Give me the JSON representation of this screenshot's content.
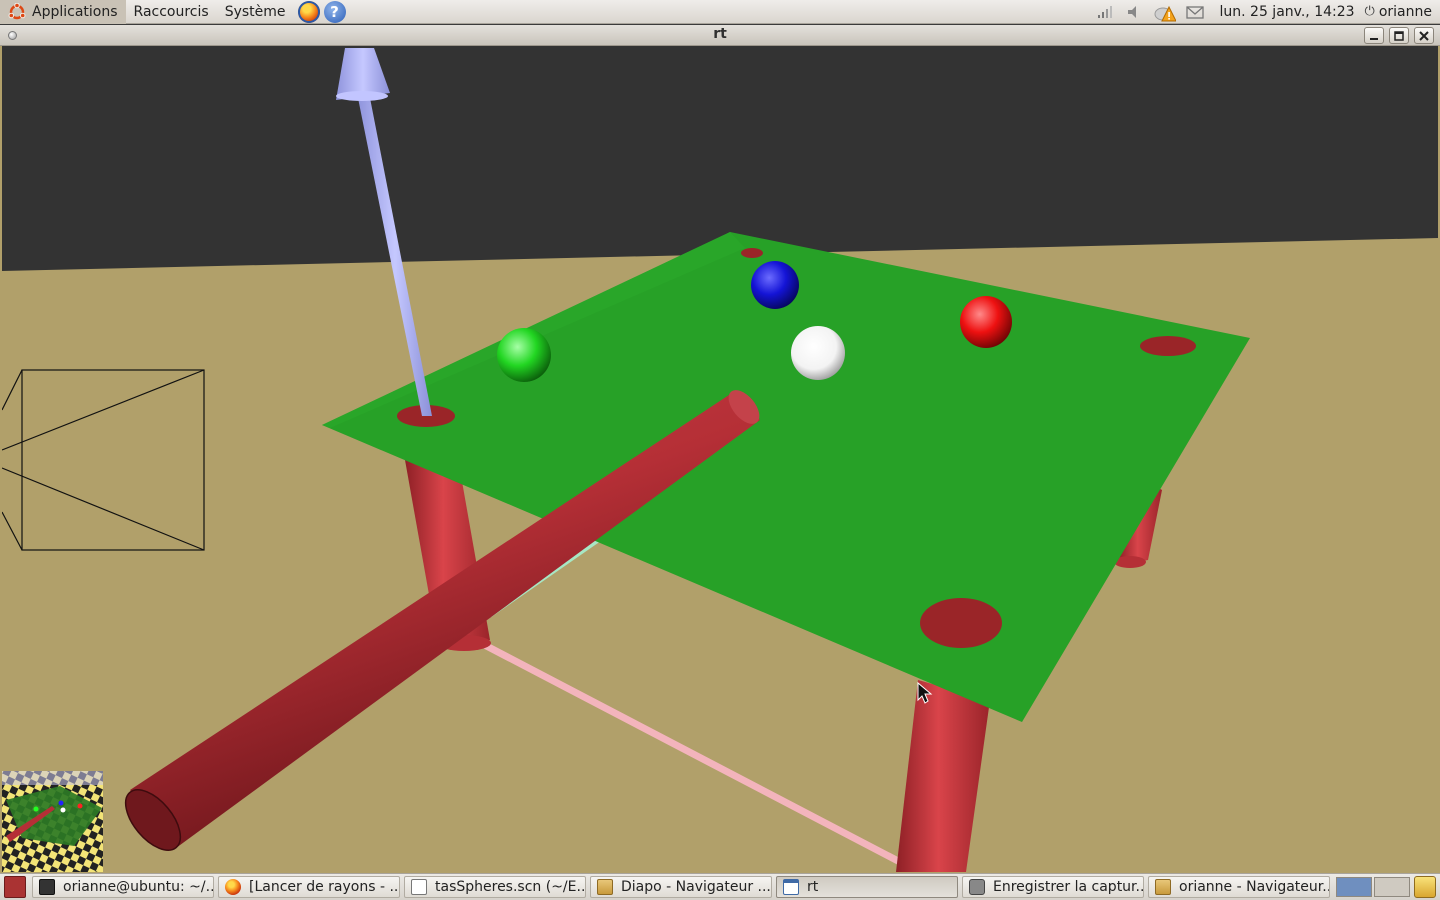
{
  "top_panel": {
    "menus": [
      "Applications",
      "Raccourcis",
      "Système"
    ],
    "clock": "lun. 25 janv., 14:23",
    "user": "orianne",
    "icons": [
      "ubuntu-logo-icon",
      "firefox-icon",
      "help-icon",
      "network-icon",
      "volume-icon",
      "update-warning-icon",
      "mail-icon",
      "power-icon"
    ]
  },
  "window": {
    "title": "rt"
  },
  "taskbar": {
    "tasks": [
      {
        "label": "orianne@ubuntu: ~/...",
        "icon": "terminal-icon"
      },
      {
        "label": "[Lancer de rayons - ...",
        "icon": "firefox-icon"
      },
      {
        "label": "tasSpheres.scn (~/E...",
        "icon": "text-editor-icon"
      },
      {
        "label": "Diapo - Navigateur ...",
        "icon": "folder-icon"
      },
      {
        "label": "rt",
        "icon": "window-icon",
        "active": true
      },
      {
        "label": "Enregistrer la captur...",
        "icon": "screenshot-icon"
      },
      {
        "label": "orianne - Navigateur...",
        "icon": "folder-icon"
      }
    ]
  },
  "scene": {
    "colors": {
      "wall": "#333333",
      "floor": "#b1a06a",
      "table": "#27a127",
      "legs": "#c8333a",
      "holes": "#9a2528",
      "cue": "#b52f36",
      "axis_vertical": "#a9aef2",
      "axis_pink": "#f3b4bc",
      "axis_green": "#a7e7c4",
      "ball_blue": "#1414d6",
      "ball_red": "#ee1111",
      "ball_green": "#22d622",
      "ball_white": "#ffffff"
    }
  }
}
